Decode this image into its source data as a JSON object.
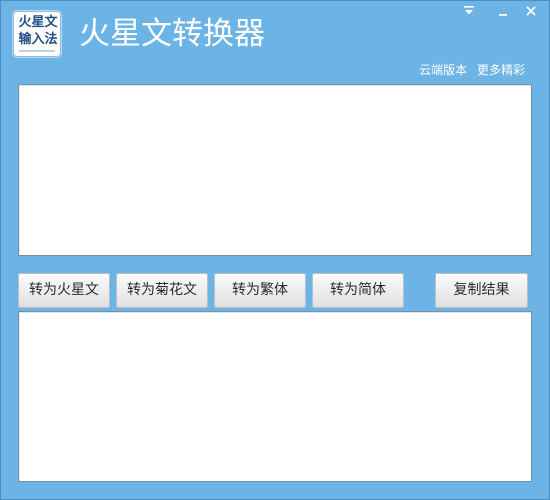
{
  "app": {
    "title": "火星文转换器",
    "logo_line1": "火星文",
    "logo_line2": "输入法"
  },
  "window_controls": {
    "menu_icon": "dropdown-menu-icon",
    "minimize_icon": "minimize-icon",
    "close_icon": "close-icon"
  },
  "top_links": {
    "cloud_version": "云端版本",
    "more": "更多精彩"
  },
  "input": {
    "value": "",
    "placeholder": ""
  },
  "buttons": {
    "to_huoxingwen": "转为火星文",
    "to_juhuawen": "转为菊花文",
    "to_fanti": "转为繁体",
    "to_jianti": "转为简体",
    "copy_result": "复制结果"
  },
  "output": {
    "value": "",
    "placeholder": ""
  },
  "colors": {
    "window_background": "#6cb4e6",
    "title_text": "#ffffff",
    "button_text": "#2b2b2b"
  }
}
